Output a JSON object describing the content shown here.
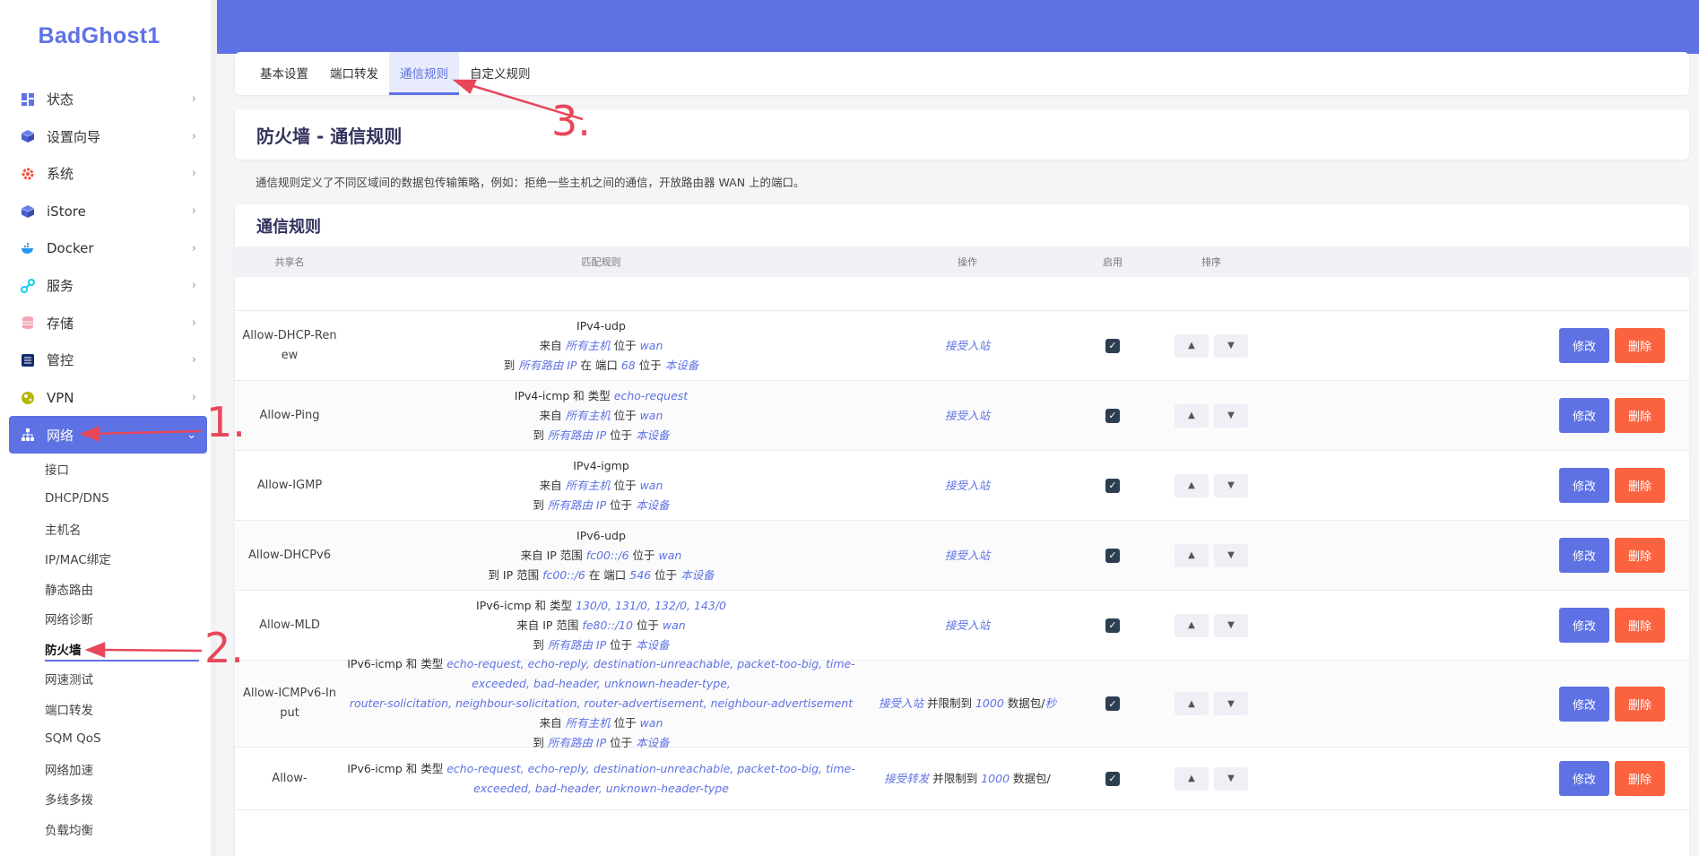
{
  "brand": "BadGhost1",
  "nav": [
    {
      "label": "状态",
      "icon": "dashboard-icon"
    },
    {
      "label": "设置向导",
      "icon": "cube-icon"
    },
    {
      "label": "系统",
      "icon": "gear-icon"
    },
    {
      "label": "iStore",
      "icon": "cube-icon"
    },
    {
      "label": "Docker",
      "icon": "docker-icon"
    },
    {
      "label": "服务",
      "icon": "link-icon"
    },
    {
      "label": "存储",
      "icon": "database-icon"
    },
    {
      "label": "管控",
      "icon": "sliders-icon"
    },
    {
      "label": "VPN",
      "icon": "globe-icon"
    },
    {
      "label": "网络",
      "icon": "network-icon"
    }
  ],
  "sub_nav": [
    "接口",
    "DHCP/DNS",
    "主机名",
    "IP/MAC绑定",
    "静态路由",
    "网络诊断",
    "防火墙",
    "网速测试",
    "端口转发",
    "SQM QoS",
    "网络加速",
    "多线多拨",
    "负载均衡"
  ],
  "tabs": [
    "基本设置",
    "端口转发",
    "通信规则",
    "自定义规则"
  ],
  "page_title": "防火墙 - 通信规则",
  "description": "通信规则定义了不同区域间的数据包传输策略，例如：拒绝一些主机之间的通信，开放路由器 WAN 上的端口。",
  "section_title": "通信规则",
  "columns": {
    "name": "共享名",
    "match": "匹配规则",
    "action": "操作",
    "enabled": "启用",
    "sort": "排序"
  },
  "buttons": {
    "edit": "修改",
    "delete": "删除"
  },
  "rows": [
    {
      "name": "Allow-DHCP-Renew",
      "match": [
        [
          {
            "t": "IPv4-udp"
          }
        ],
        [
          {
            "t": "来自 "
          },
          {
            "t": "所有主机",
            "i": 1
          },
          {
            "t": " 位于 "
          },
          {
            "t": "wan",
            "i": 1
          }
        ],
        [
          {
            "t": "到 "
          },
          {
            "t": "所有路由 IP",
            "i": 1
          },
          {
            "t": " 在 端口 "
          },
          {
            "t": "68",
            "i": 1
          },
          {
            "t": " 位于 "
          },
          {
            "t": "本设备",
            "i": 1
          }
        ]
      ],
      "action": [
        {
          "t": "接受入站",
          "i": 1
        }
      ],
      "enabled": true
    },
    {
      "name": "Allow-Ping",
      "match": [
        [
          {
            "t": "IPv4-icmp 和 类型 "
          },
          {
            "t": "echo-request",
            "i": 1
          }
        ],
        [
          {
            "t": "来自 "
          },
          {
            "t": "所有主机",
            "i": 1
          },
          {
            "t": " 位于 "
          },
          {
            "t": "wan",
            "i": 1
          }
        ],
        [
          {
            "t": "到 "
          },
          {
            "t": "所有路由 IP",
            "i": 1
          },
          {
            "t": " 位于 "
          },
          {
            "t": "本设备",
            "i": 1
          }
        ]
      ],
      "action": [
        {
          "t": "接受入站",
          "i": 1
        }
      ],
      "enabled": true
    },
    {
      "name": "Allow-IGMP",
      "match": [
        [
          {
            "t": "IPv4-igmp"
          }
        ],
        [
          {
            "t": "来自 "
          },
          {
            "t": "所有主机",
            "i": 1
          },
          {
            "t": " 位于 "
          },
          {
            "t": "wan",
            "i": 1
          }
        ],
        [
          {
            "t": "到 "
          },
          {
            "t": "所有路由 IP",
            "i": 1
          },
          {
            "t": " 位于 "
          },
          {
            "t": "本设备",
            "i": 1
          }
        ]
      ],
      "action": [
        {
          "t": "接受入站",
          "i": 1
        }
      ],
      "enabled": true
    },
    {
      "name": "Allow-DHCPv6",
      "match": [
        [
          {
            "t": "IPv6-udp"
          }
        ],
        [
          {
            "t": "来自 IP 范围 "
          },
          {
            "t": "fc00::/6",
            "i": 1
          },
          {
            "t": " 位于 "
          },
          {
            "t": "wan",
            "i": 1
          }
        ],
        [
          {
            "t": "到 IP 范围 "
          },
          {
            "t": "fc00::/6",
            "i": 1
          },
          {
            "t": " 在 端口 "
          },
          {
            "t": "546",
            "i": 1
          },
          {
            "t": " 位于 "
          },
          {
            "t": "本设备",
            "i": 1
          }
        ]
      ],
      "action": [
        {
          "t": "接受入站",
          "i": 1
        }
      ],
      "enabled": true
    },
    {
      "name": "Allow-MLD",
      "match": [
        [
          {
            "t": "IPv6-icmp 和 类型 "
          },
          {
            "t": "130/0, 131/0, 132/0, 143/0",
            "i": 1
          }
        ],
        [
          {
            "t": "来自 IP 范围 "
          },
          {
            "t": "fe80::/10",
            "i": 1
          },
          {
            "t": " 位于 "
          },
          {
            "t": "wan",
            "i": 1
          }
        ],
        [
          {
            "t": "到 "
          },
          {
            "t": "所有路由 IP",
            "i": 1
          },
          {
            "t": " 位于 "
          },
          {
            "t": "本设备",
            "i": 1
          }
        ]
      ],
      "action": [
        {
          "t": "接受入站",
          "i": 1
        }
      ],
      "enabled": true
    },
    {
      "name": "Allow-ICMPv6-Input",
      "match": [
        [
          {
            "t": "IPv6-icmp 和 类型 "
          },
          {
            "t": "echo-request, echo-reply, destination-unreachable, packet-too-big, time-exceeded, bad-header, unknown-header-type,",
            "i": 1
          }
        ],
        [
          {
            "t": "router-solicitation, neighbour-solicitation, router-advertisement, neighbour-advertisement",
            "i": 1
          }
        ],
        [
          {
            "t": "来自 "
          },
          {
            "t": "所有主机",
            "i": 1
          },
          {
            "t": " 位于 "
          },
          {
            "t": "wan",
            "i": 1
          }
        ],
        [
          {
            "t": "到 "
          },
          {
            "t": "所有路由 IP",
            "i": 1
          },
          {
            "t": " 位于 "
          },
          {
            "t": "本设备",
            "i": 1
          }
        ]
      ],
      "action": [
        {
          "t": "接受入站",
          "i": 1
        },
        {
          "t": " 并限制到 "
        },
        {
          "t": "1000",
          "i": 1
        },
        {
          "t": " 数据包/"
        },
        {
          "t": "秒",
          "i": 1
        }
      ],
      "enabled": true
    },
    {
      "name": "Allow-",
      "match": [
        [
          {
            "t": "IPv6-icmp 和 类型 "
          },
          {
            "t": "echo-request, echo-reply, destination-unreachable, packet-too-big, time-exceeded, bad-header, unknown-header-type",
            "i": 1
          }
        ]
      ],
      "action": [
        {
          "t": "接受转发",
          "i": 1
        },
        {
          "t": " 并限制到 "
        },
        {
          "t": "1000",
          "i": 1
        },
        {
          "t": " 数据包/"
        }
      ],
      "enabled": true
    }
  ],
  "annotations": [
    "1.",
    "2.",
    "3."
  ]
}
